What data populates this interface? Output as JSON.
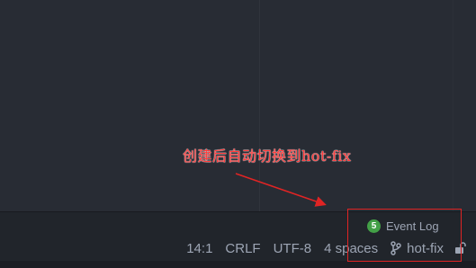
{
  "annotation": {
    "text": "创建后自动切换到hot-fix",
    "color": "#ff3b3b"
  },
  "event_log": {
    "count": "5",
    "label": "Event Log",
    "badge_color": "#43a047"
  },
  "status_bar": {
    "position": "14:1",
    "line_separator": "CRLF",
    "encoding": "UTF-8",
    "indent": "4 spaces",
    "branch": "hot-fix",
    "branch_icon": "git-branch-icon",
    "lock_icon": "unlock-icon"
  },
  "colors": {
    "editor_bg": "#282c34",
    "bar_bg": "#21252b",
    "text": "#9da5b4",
    "highlight": "#e02424"
  }
}
